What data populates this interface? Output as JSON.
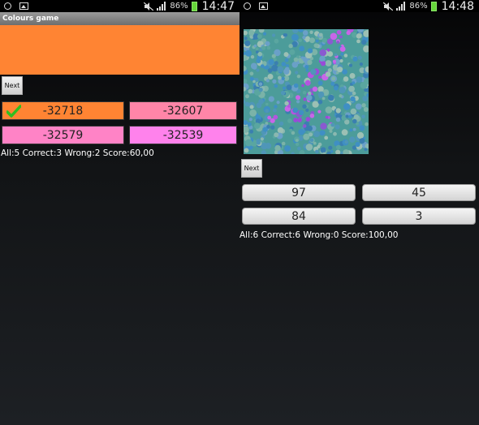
{
  "left": {
    "status": {
      "battery": "86%",
      "time": "14:47"
    },
    "title": "Colours game",
    "swatch_color": "#ff8433",
    "next_label": "Next",
    "answers": [
      {
        "label": "-32718",
        "color": "#ff8433",
        "correct": true
      },
      {
        "label": "-32607",
        "color": "#ff85a8"
      },
      {
        "label": "-32579",
        "color": "#ff83c6"
      },
      {
        "label": "-32539",
        "color": "#ff82ec"
      }
    ],
    "score_text": "All:5 Correct:3 Wrong:2 Score:60,00"
  },
  "right": {
    "status": {
      "battery": "86%",
      "time": "14:48"
    },
    "next_label": "Next",
    "answers": [
      "97",
      "45",
      "84",
      "3"
    ],
    "score_text": "All:6 Correct:6 Wrong:0 Score:100,00"
  },
  "icons": [
    "alarm-icon",
    "image-icon",
    "mute-icon",
    "signal-icon",
    "battery-icon",
    "check-icon"
  ]
}
